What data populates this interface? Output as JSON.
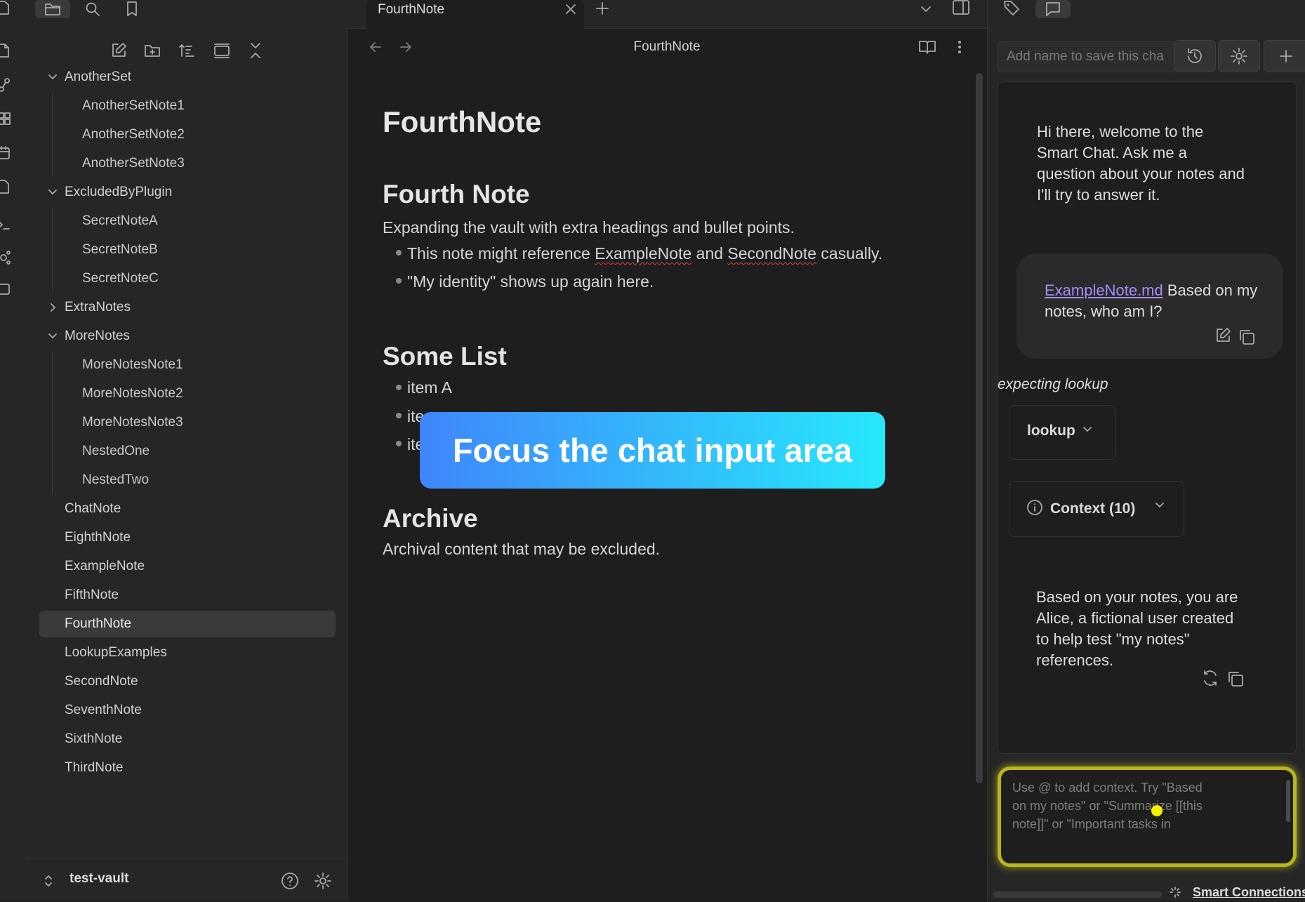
{
  "tabs": {
    "active_title": "FourthNote"
  },
  "explorer": {
    "tree": [
      {
        "label": "AnotherSet",
        "type": "folder",
        "expanded": true
      },
      {
        "label": "AnotherSetNote1",
        "type": "file"
      },
      {
        "label": "AnotherSetNote2",
        "type": "file"
      },
      {
        "label": "AnotherSetNote3",
        "type": "file"
      },
      {
        "label": "ExcludedByPlugin",
        "type": "folder",
        "expanded": true
      },
      {
        "label": "SecretNoteA",
        "type": "file"
      },
      {
        "label": "SecretNoteB",
        "type": "file"
      },
      {
        "label": "SecretNoteC",
        "type": "file"
      },
      {
        "label": "ExtraNotes",
        "type": "folder",
        "expanded": false
      },
      {
        "label": "MoreNotes",
        "type": "folder",
        "expanded": true
      },
      {
        "label": "MoreNotesNote1",
        "type": "file"
      },
      {
        "label": "MoreNotesNote2",
        "type": "file"
      },
      {
        "label": "MoreNotesNote3",
        "type": "file"
      },
      {
        "label": "NestedOne",
        "type": "file"
      },
      {
        "label": "NestedTwo",
        "type": "file"
      },
      {
        "label": "ChatNote",
        "type": "file"
      },
      {
        "label": "EighthNote",
        "type": "file"
      },
      {
        "label": "ExampleNote",
        "type": "file"
      },
      {
        "label": "FifthNote",
        "type": "file"
      },
      {
        "label": "FourthNote",
        "type": "file",
        "active": true
      },
      {
        "label": "LookupExamples",
        "type": "file"
      },
      {
        "label": "SecondNote",
        "type": "file"
      },
      {
        "label": "SeventhNote",
        "type": "file"
      },
      {
        "label": "SixthNote",
        "type": "file"
      },
      {
        "label": "ThirdNote",
        "type": "file"
      }
    ],
    "vault_name": "test-vault"
  },
  "note": {
    "header_title": "FourthNote",
    "title": "FourthNote",
    "sections": {
      "fourth": {
        "heading": "Fourth Note",
        "intro": "Expanding the vault with extra headings and bullet points.",
        "bullet1_pre": "This note might reference ",
        "bullet1_link1": "ExampleNote",
        "bullet1_mid": " and ",
        "bullet1_link2": "SecondNote",
        "bullet1_post": " casually.",
        "bullet2": "\"My identity\" shows up again here."
      },
      "list": {
        "heading": "Some List",
        "items": [
          "item A",
          "ite",
          "ite"
        ]
      },
      "archive": {
        "heading": "Archive",
        "text": "Archival content that may be excluded."
      }
    }
  },
  "overlay": {
    "text": "Focus the chat input area"
  },
  "chat": {
    "name_placeholder": "Add name to save this cha",
    "welcome": "Hi there, welcome to the Smart Chat. Ask me a question about your notes and I'll try to answer it.",
    "user_link": "ExampleNote.md",
    "user_text": " Based on my notes, who am I?",
    "expecting": "expecting lookup",
    "lookup_label": "lookup",
    "context_label": "Context (10)",
    "answer": "Based on your notes, you are Alice, a fictional user created to help test \"my notes\" references.",
    "input_placeholder": "Use @ to add context. Try \"Based on my notes\" or \"Summarize [[this note]]\" or \"Important tasks in",
    "footer_label": "Smart Connections"
  },
  "colors": {
    "accent_link": "#a68bf8",
    "highlight_ring": "#b8b71c",
    "overlay_start": "#3f86fb",
    "overlay_end": "#27e8fb"
  }
}
